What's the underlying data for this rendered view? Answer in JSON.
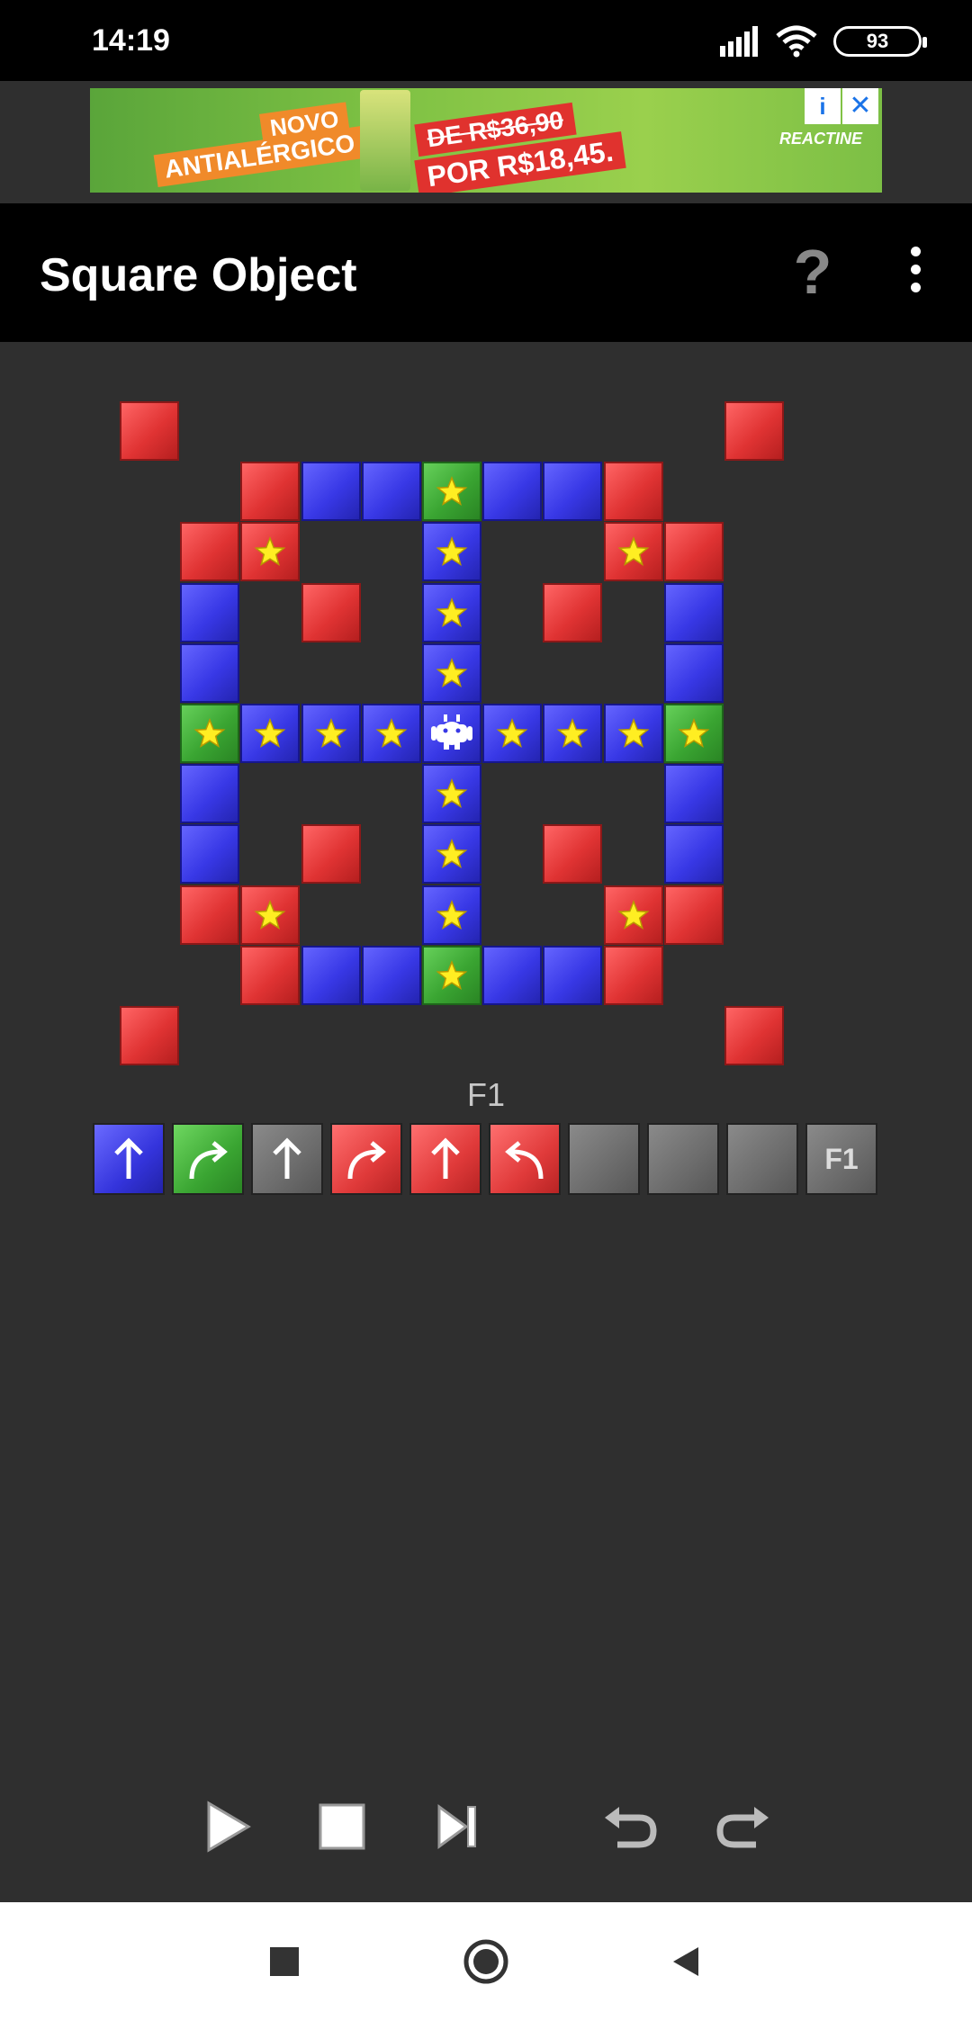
{
  "status_bar": {
    "time": "14:19",
    "battery": "93",
    "icons": [
      "signal-icon",
      "wifi-icon",
      "battery-icon"
    ]
  },
  "ad": {
    "tag_line1": "NOVO",
    "tag_line2": "ANTIALÉRGICO",
    "old_price": "DE R$36,90",
    "new_price": "POR R$18,45.",
    "brand": "REACTINE",
    "info_icon": "i",
    "close_icon": "✕"
  },
  "app_bar": {
    "title": "Square Object",
    "help_icon": "?",
    "menu_icon": "more-vert-icon"
  },
  "colors": {
    "red": "#e03333",
    "blue": "#3838e6",
    "green": "#3aa532",
    "gray": "#6c6c6c",
    "star": "#ffee22",
    "background": "#2f2f2f"
  },
  "board": {
    "columns": 11,
    "rows": 11,
    "cells": [
      {
        "c": 0,
        "r": 0,
        "color": "red",
        "star": false
      },
      {
        "c": 10,
        "r": 0,
        "color": "red",
        "star": false
      },
      {
        "c": 2,
        "r": 1,
        "color": "red",
        "star": false
      },
      {
        "c": 3,
        "r": 1,
        "color": "blue",
        "star": false
      },
      {
        "c": 4,
        "r": 1,
        "color": "blue",
        "star": false
      },
      {
        "c": 5,
        "r": 1,
        "color": "green",
        "star": true
      },
      {
        "c": 6,
        "r": 1,
        "color": "blue",
        "star": false
      },
      {
        "c": 7,
        "r": 1,
        "color": "blue",
        "star": false
      },
      {
        "c": 8,
        "r": 1,
        "color": "red",
        "star": false
      },
      {
        "c": 1,
        "r": 2,
        "color": "red",
        "star": false
      },
      {
        "c": 2,
        "r": 2,
        "color": "red",
        "star": true
      },
      {
        "c": 5,
        "r": 2,
        "color": "blue",
        "star": true
      },
      {
        "c": 8,
        "r": 2,
        "color": "red",
        "star": true
      },
      {
        "c": 9,
        "r": 2,
        "color": "red",
        "star": false
      },
      {
        "c": 1,
        "r": 3,
        "color": "blue",
        "star": false
      },
      {
        "c": 3,
        "r": 3,
        "color": "red",
        "star": false
      },
      {
        "c": 5,
        "r": 3,
        "color": "blue",
        "star": true
      },
      {
        "c": 7,
        "r": 3,
        "color": "red",
        "star": false
      },
      {
        "c": 9,
        "r": 3,
        "color": "blue",
        "star": false
      },
      {
        "c": 1,
        "r": 4,
        "color": "blue",
        "star": false
      },
      {
        "c": 5,
        "r": 4,
        "color": "blue",
        "star": true
      },
      {
        "c": 9,
        "r": 4,
        "color": "blue",
        "star": false
      },
      {
        "c": 1,
        "r": 5,
        "color": "green",
        "star": true
      },
      {
        "c": 2,
        "r": 5,
        "color": "blue",
        "star": true
      },
      {
        "c": 3,
        "r": 5,
        "color": "blue",
        "star": true
      },
      {
        "c": 4,
        "r": 5,
        "color": "blue",
        "star": true
      },
      {
        "c": 5,
        "r": 5,
        "color": "blue",
        "star": false,
        "robot": true
      },
      {
        "c": 6,
        "r": 5,
        "color": "blue",
        "star": true
      },
      {
        "c": 7,
        "r": 5,
        "color": "blue",
        "star": true
      },
      {
        "c": 8,
        "r": 5,
        "color": "blue",
        "star": true
      },
      {
        "c": 9,
        "r": 5,
        "color": "green",
        "star": true
      },
      {
        "c": 1,
        "r": 6,
        "color": "blue",
        "star": false
      },
      {
        "c": 5,
        "r": 6,
        "color": "blue",
        "star": true
      },
      {
        "c": 9,
        "r": 6,
        "color": "blue",
        "star": false
      },
      {
        "c": 1,
        "r": 7,
        "color": "blue",
        "star": false
      },
      {
        "c": 3,
        "r": 7,
        "color": "red",
        "star": false
      },
      {
        "c": 5,
        "r": 7,
        "color": "blue",
        "star": true
      },
      {
        "c": 7,
        "r": 7,
        "color": "red",
        "star": false
      },
      {
        "c": 9,
        "r": 7,
        "color": "blue",
        "star": false
      },
      {
        "c": 1,
        "r": 8,
        "color": "red",
        "star": false
      },
      {
        "c": 2,
        "r": 8,
        "color": "red",
        "star": true
      },
      {
        "c": 5,
        "r": 8,
        "color": "blue",
        "star": true
      },
      {
        "c": 8,
        "r": 8,
        "color": "red",
        "star": true
      },
      {
        "c": 9,
        "r": 8,
        "color": "red",
        "star": false
      },
      {
        "c": 2,
        "r": 9,
        "color": "red",
        "star": false
      },
      {
        "c": 3,
        "r": 9,
        "color": "blue",
        "star": false
      },
      {
        "c": 4,
        "r": 9,
        "color": "blue",
        "star": false
      },
      {
        "c": 5,
        "r": 9,
        "color": "green",
        "star": true
      },
      {
        "c": 6,
        "r": 9,
        "color": "blue",
        "star": false
      },
      {
        "c": 7,
        "r": 9,
        "color": "blue",
        "star": false
      },
      {
        "c": 8,
        "r": 9,
        "color": "red",
        "star": false
      },
      {
        "c": 0,
        "r": 10,
        "color": "red",
        "star": false
      },
      {
        "c": 10,
        "r": 10,
        "color": "red",
        "star": false
      }
    ]
  },
  "program": {
    "label": "F1",
    "slots": [
      {
        "color": "blue",
        "command": "forward"
      },
      {
        "color": "green",
        "command": "turn-right"
      },
      {
        "color": "gray",
        "command": "forward"
      },
      {
        "color": "red",
        "command": "turn-right"
      },
      {
        "color": "red",
        "command": "forward"
      },
      {
        "color": "red",
        "command": "turn-left"
      },
      {
        "color": "gray",
        "command": "empty"
      },
      {
        "color": "gray",
        "command": "empty"
      },
      {
        "color": "gray",
        "command": "empty"
      },
      {
        "color": "gray",
        "command": "call",
        "label": "F1"
      }
    ]
  },
  "controls": [
    "play-icon",
    "stop-icon",
    "step-icon",
    "undo-icon",
    "redo-icon"
  ],
  "nav_bar": [
    "recents-icon",
    "home-icon",
    "back-icon"
  ]
}
